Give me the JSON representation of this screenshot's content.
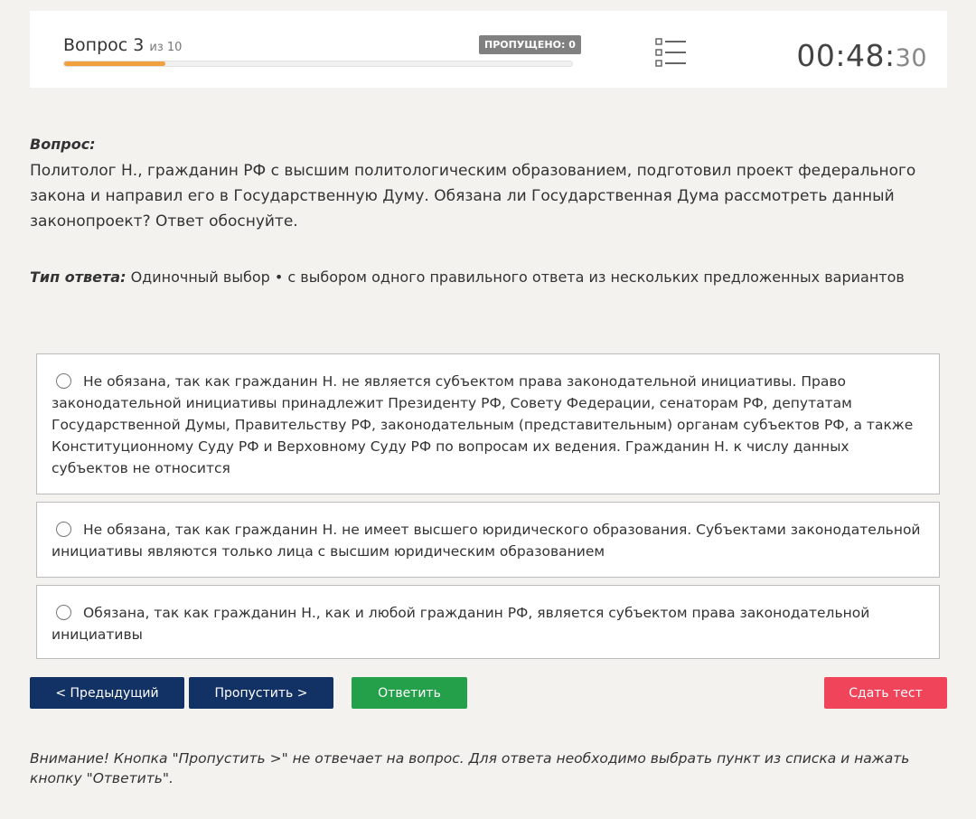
{
  "header": {
    "question_word": "Вопрос 3",
    "of_total": "из 10",
    "progress": 0.2,
    "skipped_badge": "ПРОПУЩЕНО: 0",
    "list_icon": "question-list-icon",
    "timer_main": "00:48:",
    "timer_seconds": "30"
  },
  "question": {
    "label": "Вопрос:",
    "text": "Политолог Н., гражданин РФ с высшим политологическим образованием, подготовил проект федерального закона и направил его в Государственную Думу. Обязана ли Государственная Дума рассмотреть данный законопроект? Ответ обоснуйте."
  },
  "answer_type": {
    "label": "Тип ответа:",
    "value": "Одиночный выбор • с выбором одного правильного ответа из нескольких предложенных вариантов"
  },
  "options": [
    {
      "text": "Не обязана, так как гражданин Н. не является субъектом права законодательной инициативы. Право законодательной инициативы принадлежит Президенту РФ, Совету Федерации, сенаторам РФ, депутатам Государственной Думы, Правительству РФ, законодательным (представительным) органам субъектов РФ, а также Конституционному Суду РФ и Верховному Суду РФ по вопросам их ведения. Гражданин Н. к числу данных субъектов не относится"
    },
    {
      "text": "Не обязана, так как гражданин Н. не имеет высшего юридического образования. Субъектами законодательной инициативы являются только лица с высшим юридическим образованием"
    },
    {
      "text": "Обязана, так как гражданин Н., как и любой гражданин РФ, является субъектом права законодательной инициативы"
    }
  ],
  "buttons": {
    "prev": "< Предыдущий",
    "skip": "Пропустить >",
    "answer": "Ответить",
    "submit": "Сдать тест"
  },
  "note": "Внимание! Кнопка \"Пропустить >\" не отвечает на вопрос. Для ответа необходимо выбрать пункт из списка и нажать кнопку \"Ответить\".",
  "colors": {
    "accent_dark_blue": "#123266",
    "answer_green": "#24a04b",
    "submit_red": "#f0445a",
    "progress_orange": "#f0a03c"
  }
}
